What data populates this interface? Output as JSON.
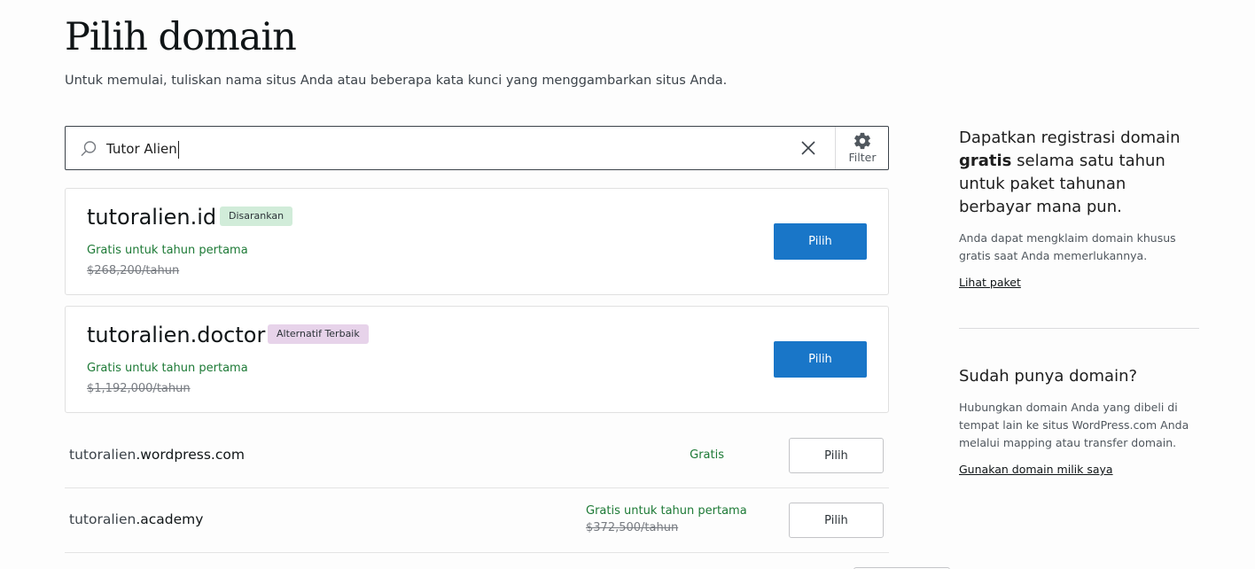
{
  "header": {
    "title": "Pilih domain",
    "subtitle": "Untuk memulai, tuliskan nama situs Anda atau beberapa kata kunci yang menggambarkan situs Anda."
  },
  "search": {
    "value": "Tutor Alien",
    "filter_label": "Filter",
    "icons": {
      "search": "search-icon",
      "clear": "close-icon",
      "filter": "gear-icon"
    }
  },
  "featured": [
    {
      "domain": "tutoralien.id",
      "badge": "Disarankan",
      "free_text": "Gratis untuk tahun pertama",
      "original_price": "$268,200/tahun",
      "button": "Pilih"
    },
    {
      "domain": "tutoralien.doctor",
      "badge": "Alternatif Terbaik",
      "free_text": "Gratis untuk tahun pertama",
      "original_price": "$1,192,000/tahun",
      "button": "Pilih"
    }
  ],
  "list": [
    {
      "subdomain": "tutoralien",
      "tld": ".wordpress.com",
      "price": "Gratis",
      "original_price": "",
      "button": "Pilih"
    },
    {
      "subdomain": "tutoralien",
      "tld": ".academy",
      "price": "Gratis untuk tahun pertama",
      "original_price": "$372,500/tahun",
      "button": "Pilih"
    }
  ],
  "sidebar": {
    "promo": {
      "heading_pre": "Dapatkan registrasi domain",
      "heading_bold": "gratis",
      "heading_post": "selama satu tahun untuk paket tahunan berbayar mana pun.",
      "text": "Anda dapat mengklaim domain khusus gratis saat Anda memerlukannya.",
      "link": "Lihat paket"
    },
    "own": {
      "heading": "Sudah punya domain?",
      "text": "Hubungkan domain Anda yang dibeli di tempat lain ke situs WordPress.com Anda melalui mapping atau transfer domain.",
      "link": "Gunakan domain milik saya"
    }
  },
  "colors": {
    "primary_button": "#1976c8",
    "price_green": "#1d7a36",
    "badge_recommended": "#d1ecd9",
    "badge_alternative": "#e7d3ea"
  }
}
